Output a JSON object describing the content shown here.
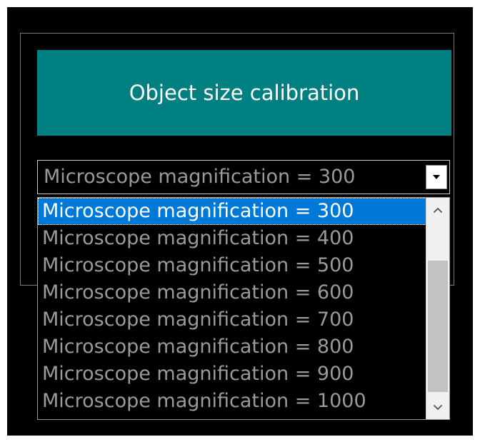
{
  "calibration": {
    "button_label": "Object size calibration"
  },
  "magnification": {
    "selected_value": "Microscope magnification = 300",
    "options": [
      "Microscope magnification = 300",
      "Microscope magnification = 400",
      "Microscope magnification = 500",
      "Microscope magnification = 600",
      "Microscope magnification = 700",
      "Microscope magnification = 800",
      "Microscope magnification = 900",
      "Microscope magnification = 1000"
    ],
    "selected_index": 0
  },
  "icons": {
    "combo_arrow": "chevron-down-icon",
    "scroll_up": "chevron-up-icon",
    "scroll_down": "chevron-down-icon"
  },
  "colors": {
    "background": "#000000",
    "button_teal": "#008080",
    "selection_blue": "#0078d7",
    "text_gray": "#9a9a9a"
  }
}
